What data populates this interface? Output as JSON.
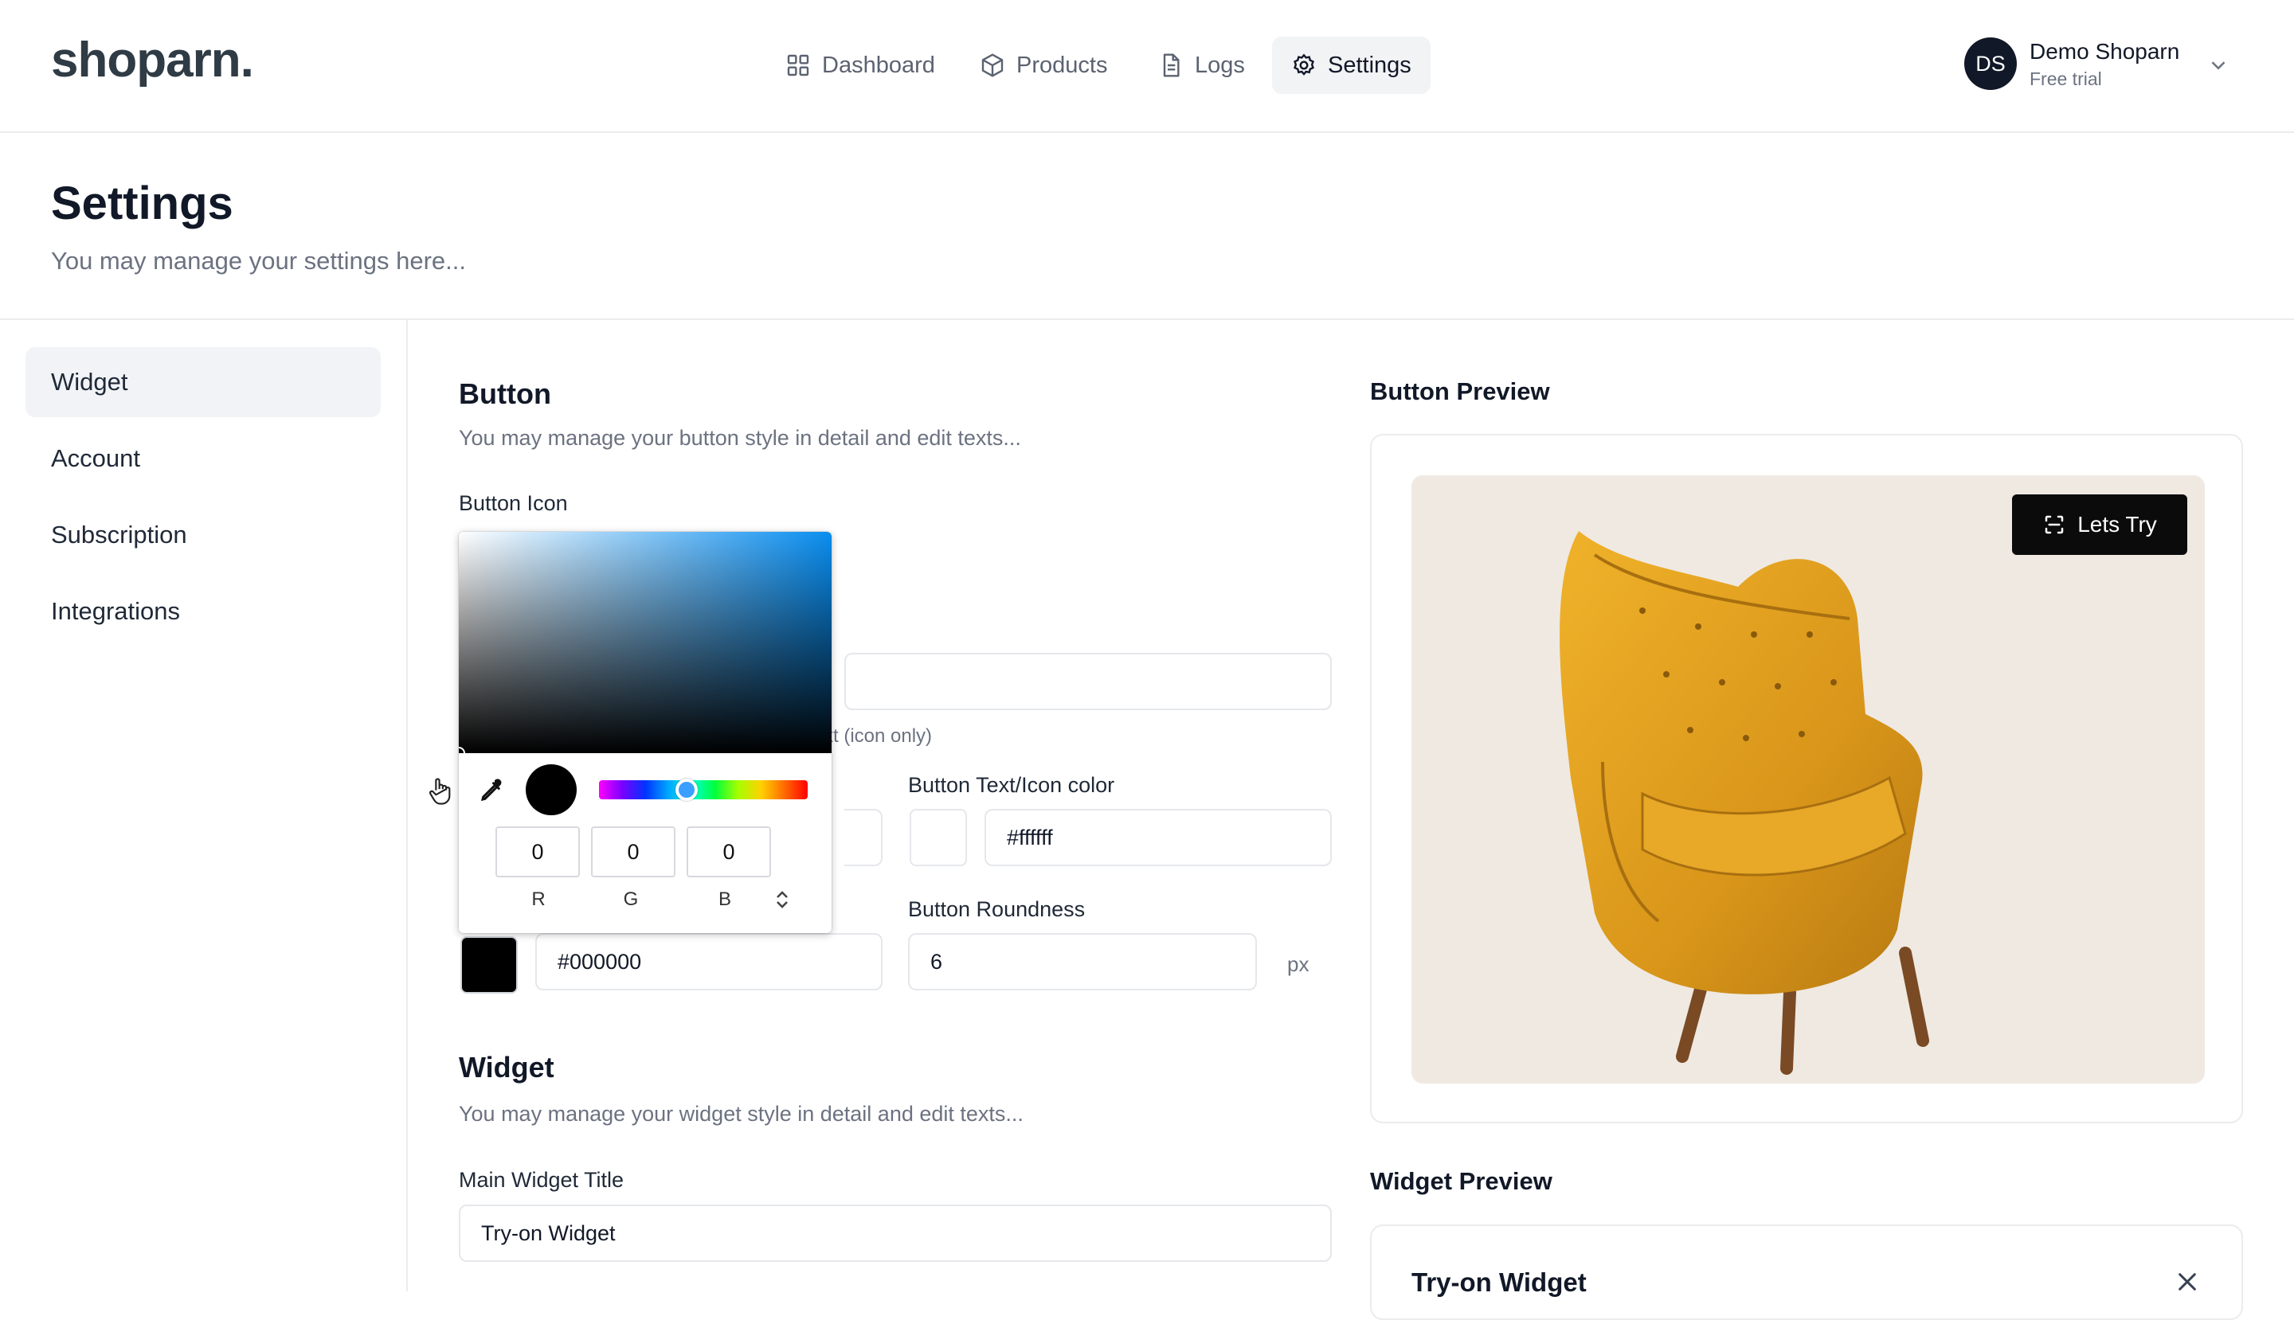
{
  "app": {
    "logo": "shoparn."
  },
  "nav": [
    {
      "label": "Dashboard",
      "icon": "grid-icon"
    },
    {
      "label": "Products",
      "icon": "box-icon"
    },
    {
      "label": "Logs",
      "icon": "document-icon"
    },
    {
      "label": "Settings",
      "icon": "gear-icon",
      "active": true
    }
  ],
  "user": {
    "initials": "DS",
    "name": "Demo Shoparn",
    "plan": "Free trial"
  },
  "page": {
    "title": "Settings",
    "subtitle": "You may manage your settings here..."
  },
  "sidebar": [
    {
      "label": "Widget",
      "active": true
    },
    {
      "label": "Account"
    },
    {
      "label": "Subscription"
    },
    {
      "label": "Integrations"
    }
  ],
  "button_section": {
    "title": "Button",
    "subtitle": "You may manage your button style in detail and edit texts...",
    "icon_label": "Button Icon",
    "icon_only_hint": "xt (icon only)",
    "text_color_label": "Button Text/Icon color",
    "text_color_value": "#ffffff",
    "bg_color_value": "#000000",
    "roundness_label": "Button Roundness",
    "roundness_value": "6",
    "roundness_unit": "px"
  },
  "color_picker": {
    "r": "0",
    "g": "0",
    "b": "0",
    "r_label": "R",
    "g_label": "G",
    "b_label": "B",
    "hue_position": 0.42,
    "selected_color": "#000000"
  },
  "widget_section": {
    "title": "Widget",
    "subtitle": "You may manage your widget style in detail and edit texts...",
    "main_title_label": "Main Widget Title",
    "main_title_value": "Try-on Widget"
  },
  "button_preview": {
    "title": "Button Preview",
    "button_label": "Lets Try"
  },
  "widget_preview": {
    "title": "Widget Preview",
    "widget_title": "Try-on Widget"
  },
  "colors": {
    "accent": "#111827",
    "preview_bg": "#efe9e2",
    "chair": "#e0a21f"
  }
}
